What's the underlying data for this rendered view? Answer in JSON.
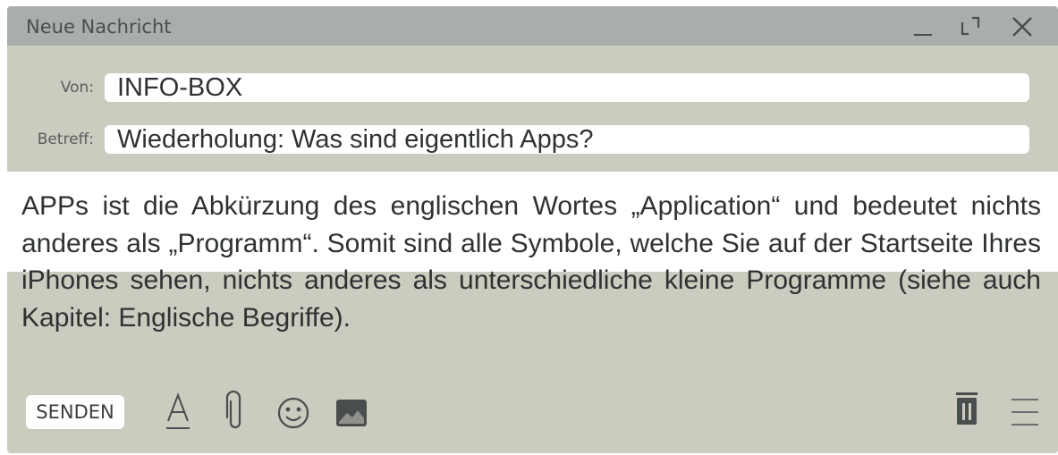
{
  "window": {
    "title": "Neue Nachricht"
  },
  "fields": {
    "from_label": "Von:",
    "from_value": "INFO-BOX",
    "subject_label": "Betreff:",
    "subject_value": "Wiederholung: Was sind eigentlich Apps?"
  },
  "message": {
    "body": "APPs ist die Abkürzung des englischen Wortes „Application“ und bedeu­tet nichts anderes als „Programm“. Somit sind alle Symbole, welche Sie auf der Startseite Ihres iPhones sehen, nichts anderes als unterschied­liche kleine Programme (siehe auch Kapitel: Englische Begriffe)."
  },
  "toolbar": {
    "send_label": "SENDEN",
    "icons": [
      "text-format-icon",
      "paperclip-icon",
      "emoji-icon",
      "image-icon",
      "trash-icon",
      "menu-icon"
    ]
  },
  "colors": {
    "window_bg": "#cbcbbf",
    "titlebar_bg": "#a9aeab",
    "icon_color": "#4a4d4d"
  }
}
